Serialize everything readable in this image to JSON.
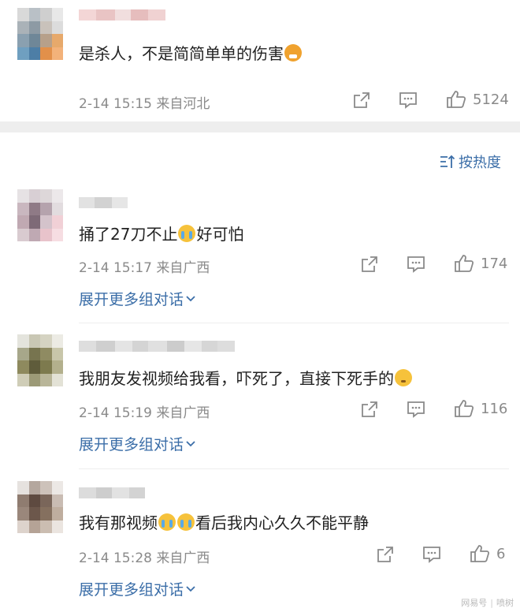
{
  "sort": {
    "label": "按热度"
  },
  "comments": [
    {
      "text_parts": [
        "是杀人，不是简简单单的伤害"
      ],
      "emoji": [
        "angry-emoji"
      ],
      "time": "2-14 15:15",
      "location": "来自河北",
      "likes": "5124",
      "expand_label": ""
    },
    {
      "text_parts": [
        "捅了27刀不止",
        "好可怕"
      ],
      "emoji": [
        "crying-emoji"
      ],
      "time": "2-14 15:17",
      "location": "来自广西",
      "likes": "174",
      "expand_label": "展开更多组对话"
    },
    {
      "text_parts": [
        "我朋友发视频给我看，吓死了，直接下死手的"
      ],
      "emoji": [
        "thinking-emoji"
      ],
      "time": "2-14 15:19",
      "location": "来自广西",
      "likes": "116",
      "expand_label": "展开更多组对话"
    },
    {
      "text_parts": [
        "我有那视频",
        "看后我内心久久不能平静"
      ],
      "emoji": [
        "crying-emoji",
        "crying-emoji"
      ],
      "time": "2-14 15:28",
      "location": "来自广西",
      "likes": "6",
      "expand_label": "展开更多组对话"
    }
  ],
  "watermark": {
    "left": "网易号",
    "right": "喷树"
  },
  "colors": {
    "link": "#3b6ea8",
    "meta": "#8a8a8a",
    "band": "#eeeeee"
  }
}
